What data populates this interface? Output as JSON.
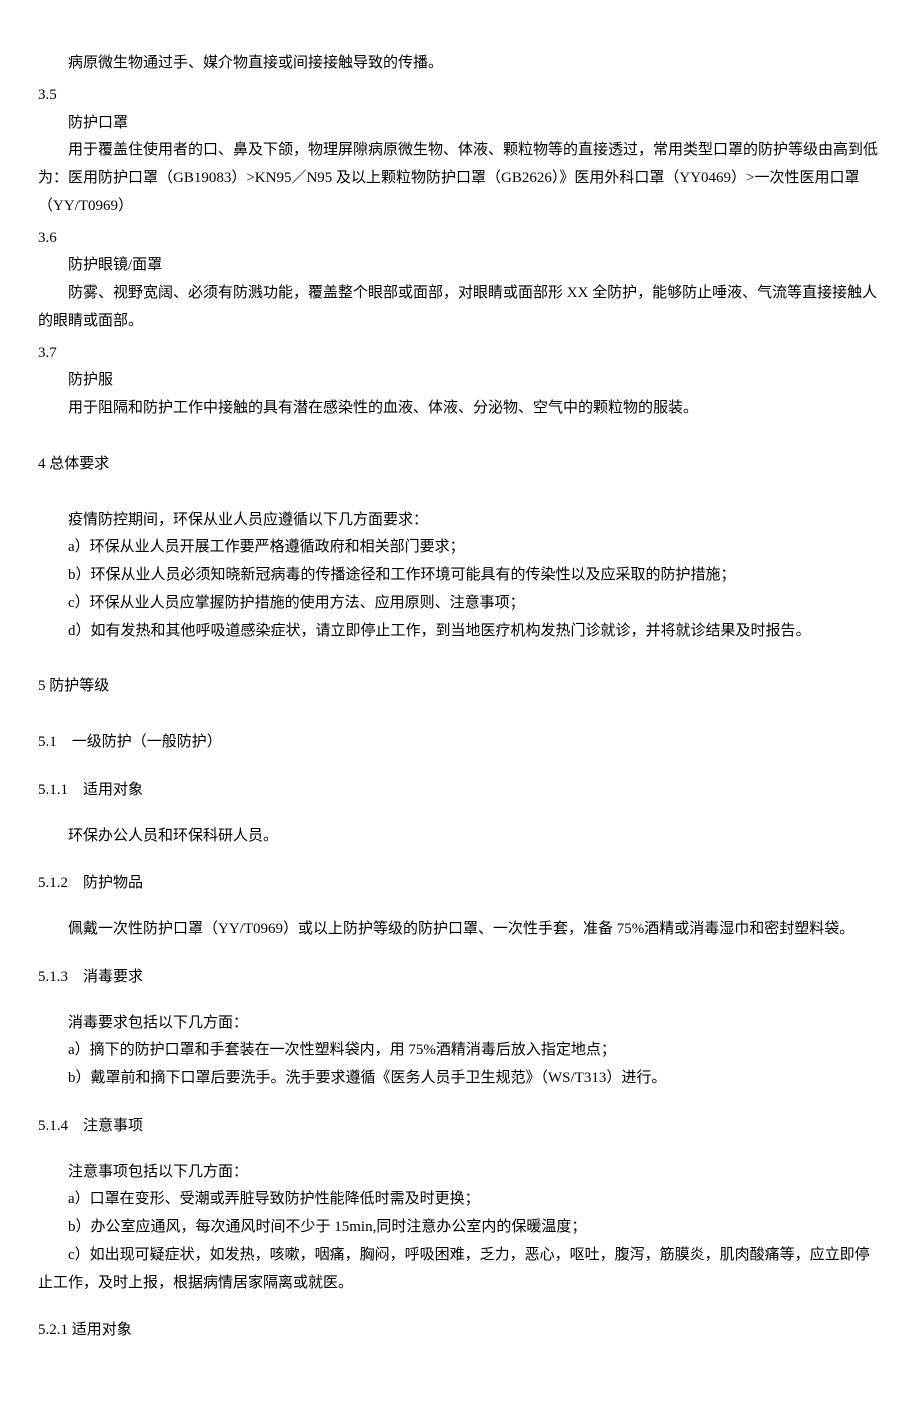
{
  "b34_p1": "病原微生物通过手、媒介物直接或间接接触导致的传播。",
  "s35_num": "3.5",
  "s35_title": "防护口罩",
  "s35_p1": "用于覆盖住使用者的口、鼻及下颌，物理屏隙病原微生物、体液、颗粒物等的直接透过，常用类型口罩的防护等级由高到低为：医用防护口罩（GB19083）>KN95／N95 及以上颗粒物防护口罩（GB2626）》医用外科口罩（YY0469）>一次性医用口罩（YY/T0969）",
  "s36_num": "3.6",
  "s36_title": "防护眼镜/面罩",
  "s36_p1": "防雾、视野宽阔、必须有防溅功能，覆盖整个眼部或面部，对眼睛或面部形 XX 全防护，能够防止唾液、气流等直接接触人的眼睛或面部。",
  "s37_num": "3.7",
  "s37_title": "防护服",
  "s37_p1": "用于阻隔和防护工作中接触的具有潜在感染性的血液、体液、分泌物、空气中的颗粒物的服装。",
  "s4_h": "4 总体要求",
  "s4_p1": "疫情防控期间，环保从业人员应遵循以下几方面要求：",
  "s4_a": "a）环保从业人员开展工作要严格遵循政府和相关部门要求；",
  "s4_b": "b）环保从业人员必须知晓新冠病毒的传播途径和工作环境可能具有的传染性以及应采取的防护措施；",
  "s4_c": "c）环保从业人员应掌握防护措施的使用方法、应用原则、注意事项；",
  "s4_d": "d）如有发热和其他呼吸道感染症状，请立即停止工作，到当地医疗机构发热门诊就诊，并将就诊结果及时报告。",
  "s5_h": "5 防护等级",
  "s51_h": "5.1　一级防护（一般防护）",
  "s511_h": "5.1.1　适用对象",
  "s511_p1": "环保办公人员和环保科研人员。",
  "s512_h": "5.1.2　防护物品",
  "s512_p1": "佩戴一次性防护口罩（YY/T0969）或以上防护等级的防护口罩、一次性手套，准备 75%酒精或消毒湿巾和密封塑料袋。",
  "s513_h": "5.1.3　消毒要求",
  "s513_p1": "消毒要求包括以下几方面：",
  "s513_a": "a）摘下的防护口罩和手套装在一次性塑料袋内，用 75%酒精消毒后放入指定地点；",
  "s513_b": "b）戴罩前和摘下口罩后要洗手。洗手要求遵循《医务人员手卫生规范》（WS/T313）进行。",
  "s514_h": "5.1.4　注意事项",
  "s514_p1": "注意事项包括以下几方面：",
  "s514_a": "a）口罩在变形、受潮或弄脏导致防护性能降低时需及时更换；",
  "s514_b": "b）办公室应通风，每次通风时间不少于 15min,同时注意办公室内的保暖温度；",
  "s514_c": "c）如出现可疑症状，如发热，咳嗽，咽痛，胸闷，呼吸困难，乏力，恶心，呕吐，腹泻，筋膜炎，肌肉酸痛等，应立即停止工作，及时上报，根据病情居家隔离或就医。",
  "s521_h": "5.2.1 适用对象"
}
